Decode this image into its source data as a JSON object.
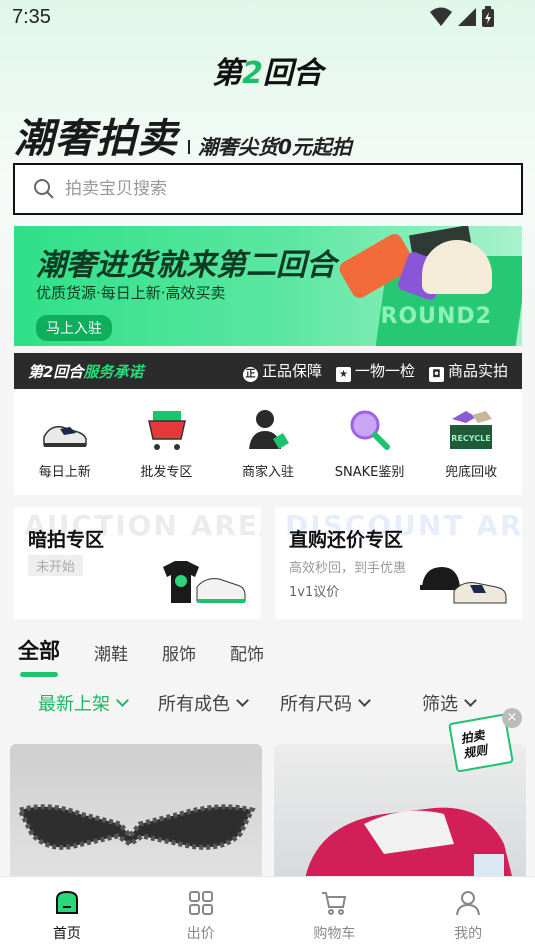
{
  "status_bar": {
    "time": "7:35"
  },
  "header": {
    "logo_prefix": "第",
    "logo_num": "2",
    "logo_suffix": "回合"
  },
  "slogan": {
    "main": "潮奢拍卖",
    "sub": "潮奢尖货0元起拍"
  },
  "search": {
    "placeholder": "拍卖宝贝搜索"
  },
  "banner": {
    "title": "潮奢进货就来第二回合",
    "subtitle": "优质货源·每日上新·高效买卖",
    "button": "马上入驻",
    "box_text": "ROUND2"
  },
  "promise": {
    "title_prefix": "第2回合",
    "title_suffix": "服务承诺",
    "items": [
      {
        "icon": "正",
        "label": "正品保障"
      },
      {
        "icon": "★",
        "label": "一物一检"
      },
      {
        "icon": "◘",
        "label": "商品实拍"
      }
    ]
  },
  "categories": [
    {
      "label": "每日上新",
      "icon": "sneaker-icon"
    },
    {
      "label": "批发专区",
      "icon": "shopping-cart-icon"
    },
    {
      "label": "商家入驻",
      "icon": "merchant-icon"
    },
    {
      "label": "SNAKE鉴别",
      "icon": "magnifier-icon"
    },
    {
      "label": "兜底回收",
      "icon": "recycle-box-icon"
    }
  ],
  "cards": {
    "auction": {
      "bg": "AUCTION AREA",
      "title": "暗拍专区",
      "tag": "未开始"
    },
    "direct": {
      "bg": "DISCOUNT AREA",
      "title": "直购还价专区",
      "desc1": "高效秒回，到手优惠",
      "desc2": "1v1议价"
    }
  },
  "tabs": [
    "全部",
    "潮鞋",
    "服饰",
    "配饰"
  ],
  "filters": [
    "最新上架",
    "所有成色",
    "所有尺码",
    "筛选"
  ],
  "rules_badge": {
    "line1": "拍卖",
    "line2": "规则",
    "close": "×"
  },
  "bottom_nav": [
    {
      "label": "首页",
      "icon": "home-icon"
    },
    {
      "label": "出价",
      "icon": "grid-icon"
    },
    {
      "label": "购物车",
      "icon": "cart-icon"
    },
    {
      "label": "我的",
      "icon": "user-icon"
    }
  ],
  "colors": {
    "accent": "#1cc46f",
    "dark": "#2b2b2b"
  }
}
